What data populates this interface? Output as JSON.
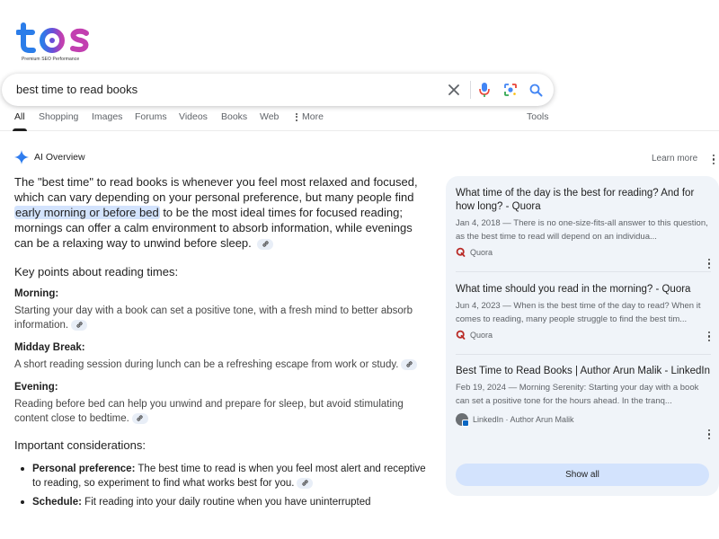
{
  "logo": {
    "text": "tos",
    "tagline": "Premium SEO Performance"
  },
  "search": {
    "query": "best time to read books",
    "clear_icon": "close-icon",
    "voice_icon": "microphone-icon",
    "lens_icon": "camera-lens-icon",
    "search_icon": "search-icon"
  },
  "tabs": [
    {
      "label": "All",
      "active": true
    },
    {
      "label": "Shopping"
    },
    {
      "label": "Images"
    },
    {
      "label": "Forums"
    },
    {
      "label": "Videos"
    },
    {
      "label": "Books"
    },
    {
      "label": "Web"
    },
    {
      "label": "More"
    }
  ],
  "tools_label": "Tools",
  "ai_overview": {
    "title": "AI Overview",
    "learn_more": "Learn more",
    "lead_part1": "The \"best time\" to read books is whenever you feel most relaxed and focused, which can vary depending on your personal preference, but many people find ",
    "lead_highlight": "early morning or before bed",
    "lead_part2": " to be the most ideal times for focused reading; mornings can offer a calm environment to absorb information, while evenings can be a relaxing way to unwind before sleep.",
    "key_points_title": "Key points about reading times:",
    "key_points": [
      {
        "title": "Morning:",
        "body": "Starting your day with a book can set a positive tone, with a fresh mind to better absorb information."
      },
      {
        "title": "Midday Break:",
        "body": "A short reading session during lunch can be a refreshing escape from work or study."
      },
      {
        "title": "Evening:",
        "body": "Reading before bed can help you unwind and prepare for sleep, but avoid stimulating content close to bedtime."
      }
    ],
    "considerations_title": "Important considerations:",
    "considerations": [
      {
        "term": "Personal preference:",
        "text": " The best time to read is when you feel most alert and receptive to reading, so experiment to find what works best for you."
      },
      {
        "term": "Schedule:",
        "text": " Fit reading into your daily routine when you have uninterrupted"
      }
    ]
  },
  "sources": [
    {
      "title": "What time of the day is the best for reading? And for how long? - Quora",
      "snippet": "Jan 4, 2018 — There is no one-size-fits-all answer to this question, as the best time to read will depend on an individua...",
      "site": "Quora"
    },
    {
      "title": "What time should you read in the morning? - Quora",
      "snippet": "Jun 4, 2023 — When is the best time of the day to read? When it comes to reading, many people struggle to find the best tim...",
      "site": "Quora"
    },
    {
      "title": "Best Time to Read Books | Author Arun Malik - LinkedIn",
      "snippet": "Feb 19, 2024 — Morning Serenity: Starting your day with a book can set a positive tone for the hours ahead. In the tranq...",
      "site": "LinkedIn · Author Arun Malik"
    }
  ],
  "show_all_label": "Show all",
  "colors": {
    "accent_blue": "#0b57d0",
    "highlight": "#d3e3fd",
    "panel_bg": "#f0f4f9",
    "quora_red": "#b92b27"
  }
}
